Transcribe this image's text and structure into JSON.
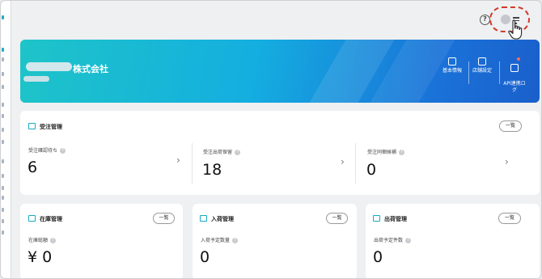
{
  "header": {
    "help_icon": "question-circle-icon",
    "avatar_icon": "user-avatar-icon",
    "menu_icon": "menu-lines-icon",
    "highlight_color": "#d23a2a"
  },
  "banner": {
    "company_suffix": "株式会社",
    "shortcuts": [
      {
        "label": "基本情報",
        "icon": "building-icon"
      },
      {
        "label": "店舗設定",
        "icon": "store-icon"
      },
      {
        "label": "API連携ロ\nグ",
        "icon": "api-log-icon"
      }
    ]
  },
  "orders": {
    "title": "受注管理",
    "list_label": "一覧",
    "metrics": [
      {
        "label": "受注確認待ち",
        "value": "6"
      },
      {
        "label": "受注出荷保留",
        "value": "18"
      },
      {
        "label": "受注同梱候補",
        "value": "0"
      }
    ]
  },
  "inventory": {
    "title": "在庫管理",
    "list_label": "一覧",
    "metric_label": "在庫総額",
    "metric_value": "¥ 0"
  },
  "receiving": {
    "title": "入荷管理",
    "list_label": "一覧",
    "metric_label": "入荷予定数量",
    "metric_value": "0"
  },
  "shipping": {
    "title": "出荷管理",
    "list_label": "一覧",
    "metric_label": "出荷予定件数",
    "metric_value": "0"
  },
  "colors": {
    "accent": "#1aa9c0",
    "banner_start": "#1ec4c8",
    "banner_end": "#1a5fcb"
  }
}
